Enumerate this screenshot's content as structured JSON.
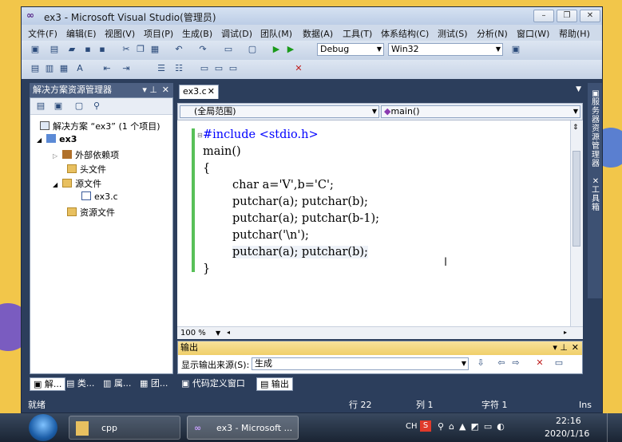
{
  "window": {
    "title": "ex3 - Microsoft Visual Studio(管理员)",
    "logo": "∞"
  },
  "menu": [
    "文件(F)",
    "编辑(E)",
    "视图(V)",
    "项目(P)",
    "生成(B)",
    "调试(D)",
    "团队(M)",
    "数据(A)",
    "工具(T)",
    "体系结构(C)",
    "测试(S)",
    "分析(N)",
    "窗口(W)",
    "帮助(H)"
  ],
  "toolbar": {
    "config": "Debug",
    "platform": "Win32"
  },
  "solution_explorer": {
    "title": "解决方案资源管理器",
    "items": [
      {
        "label": "解决方案 “ex3” (1 个项目)"
      },
      {
        "label": "ex3"
      },
      {
        "label": "外部依赖项"
      },
      {
        "label": "头文件"
      },
      {
        "label": "源文件"
      },
      {
        "label": "ex3.c"
      },
      {
        "label": "资源文件"
      }
    ]
  },
  "editor": {
    "tab": "ex3.c",
    "scope": "(全局范围)",
    "member": "main()",
    "zoom": "100 %",
    "lines": [
      "#include <stdio.h>",
      "main()",
      "{",
      "char a='V',b='C';",
      "putchar(a); putchar(b);",
      "putchar(a); putchar(b-1);",
      "putchar('\\n');",
      "putchar(a); putchar(b);",
      "}"
    ]
  },
  "output": {
    "title": "输出",
    "source_label": "显示输出来源(S):",
    "source_value": "生成"
  },
  "bottom_tabs": [
    "解...",
    "类...",
    "属...",
    "团...",
    "代码定义窗口",
    "输出"
  ],
  "right_sidebar": [
    "服务器资源管理器",
    "工具箱"
  ],
  "status": {
    "ready": "就绪",
    "row": "行 22",
    "col": "列 1",
    "char": "字符 1",
    "mode": "Ins"
  },
  "taskbar": {
    "folder": "cpp",
    "vs": "ex3 - Microsoft ...",
    "time": "22:16",
    "date": "2020/1/16",
    "ime": "CH"
  },
  "colors": {
    "keyword": "#0000ff",
    "string": "#a31515",
    "chrome": "#2c3e5c",
    "changed_bar": "#58c058"
  }
}
